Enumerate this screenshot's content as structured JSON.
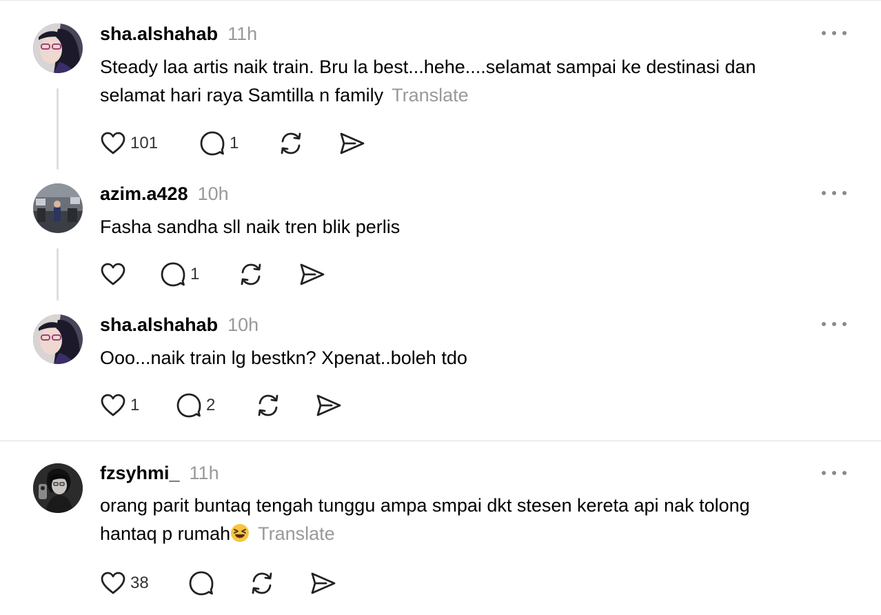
{
  "posts": [
    {
      "username": "sha.alshahab",
      "time": "11h",
      "text_lines": [
        "Steady laa artis naik train. Bru la best...hehe....selamat sampai ke destinasi dan",
        "selamat hari raya Samtilla n family"
      ],
      "translate": "Translate",
      "likes": "101",
      "replies": "1"
    },
    {
      "username": "azim.a428",
      "time": "10h",
      "text_lines": [
        "Fasha sandha sll naik tren blik perlis"
      ],
      "replies": "1"
    },
    {
      "username": "sha.alshahab",
      "time": "10h",
      "text_lines": [
        "Ooo...naik train lg bestkn? Xpenat..boleh tdo"
      ],
      "likes": "1",
      "replies": "2"
    },
    {
      "username": "fzsyhmi_",
      "time": "11h",
      "text_lines": [
        "orang parit buntaq tengah tunggu ampa smpai dkt stesen kereta api nak tolong",
        "hantaq p rumah"
      ],
      "emoji": "😆",
      "translate": "Translate",
      "likes": "38"
    }
  ],
  "icons": {
    "like": "heart-icon",
    "reply": "speech-bubble-icon",
    "repost": "repost-icon",
    "share": "send-icon",
    "more": "more-dots-icon"
  }
}
